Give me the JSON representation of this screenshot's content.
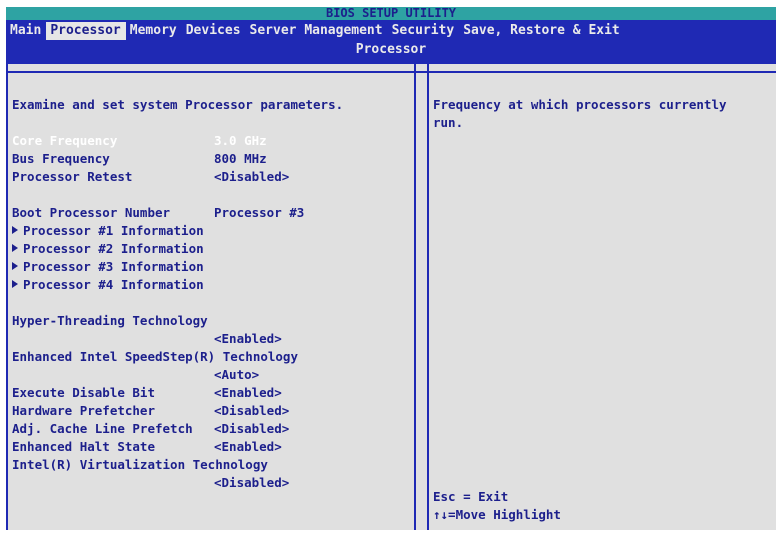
{
  "title": "BIOS SETUP UTILITY",
  "menu": [
    {
      "label": "Main"
    },
    {
      "label": "Processor"
    },
    {
      "label": "Memory"
    },
    {
      "label": "Devices"
    },
    {
      "label": "Server Management"
    },
    {
      "label": "Security"
    },
    {
      "label": "Save, Restore & Exit"
    }
  ],
  "page_title": "Processor",
  "intro": "Examine and set system Processor parameters.",
  "items": {
    "core_frequency": {
      "label": "Core Frequency",
      "value": "3.0 GHz"
    },
    "bus_frequency": {
      "label": "Bus Frequency",
      "value": "800 MHz"
    },
    "processor_retest": {
      "label": "Processor Retest",
      "value": "<Disabled>"
    },
    "boot_processor": {
      "label": "Boot Processor Number",
      "value": "Processor #3"
    },
    "proc1": {
      "label": "Processor #1 Information"
    },
    "proc2": {
      "label": "Processor #2 Information"
    },
    "proc3": {
      "label": "Processor #3 Information"
    },
    "proc4": {
      "label": "Processor #4 Information"
    },
    "hyperthreading": {
      "label": "Hyper-Threading Technology",
      "value": "<Enabled>"
    },
    "speedstep": {
      "label": "Enhanced Intel SpeedStep(R) Technology",
      "value": "<Auto>"
    },
    "xd_bit": {
      "label": "Execute Disable Bit",
      "value": "<Enabled>"
    },
    "hw_prefetch": {
      "label": "Hardware Prefetcher",
      "value": "<Disabled>"
    },
    "adj_cache": {
      "label": "Adj. Cache Line Prefetch",
      "value": "<Disabled>"
    },
    "halt_state": {
      "label": "Enhanced Halt State",
      "value": "<Enabled>"
    },
    "vt": {
      "label": "Intel(R) Virtualization Technology",
      "value": "<Disabled>"
    }
  },
  "help_text": "Frequency at which processors currently run.",
  "keys": {
    "esc": "Esc = Exit",
    "move": "↑↓=Move Highlight"
  },
  "colors": {
    "title_bg": "#2ea3a3",
    "menu_bg": "#1f29b4",
    "panel_bg": "#e0e0e0",
    "text": "#1c1f8c",
    "highlight_text": "#ffffff"
  }
}
